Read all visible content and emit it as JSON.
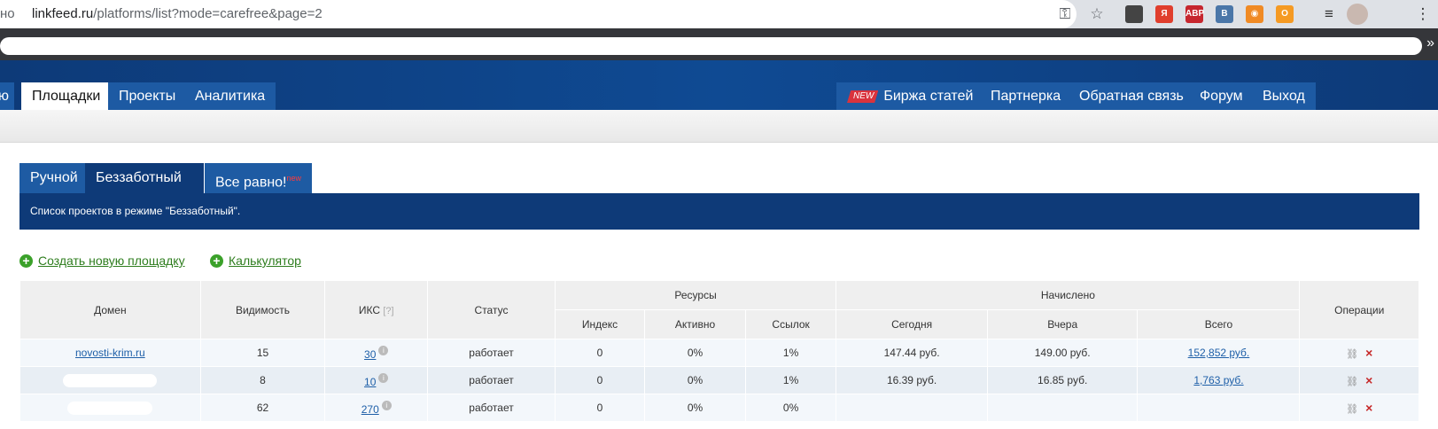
{
  "browser": {
    "url_prefix": "но",
    "url_host": "linkfeed.ru",
    "url_path": "/platforms/list?mode=carefree&page=2",
    "extensions": [
      {
        "name": "ext-ink-icon",
        "label": "",
        "color": "#444444"
      },
      {
        "name": "yandex-icon",
        "label": "Я",
        "color": "#e03e2d"
      },
      {
        "name": "adblock-icon",
        "label": "ABP",
        "color": "#c6262e"
      },
      {
        "name": "vk-icon",
        "label": "B",
        "color": "#4a76a8"
      },
      {
        "name": "rss-icon",
        "label": "◉",
        "color": "#f08a24"
      },
      {
        "name": "odnoklassniki-icon",
        "label": "О",
        "color": "#f59a23"
      }
    ],
    "more_label": "»"
  },
  "nav": {
    "left_partial": "ю",
    "items": [
      "Площадки",
      "Проекты",
      "Аналитика"
    ],
    "active": "Площадки",
    "new_badge": "NEW",
    "right_items": [
      "Биржа статей",
      "Партнерка",
      "Обратная связь",
      "Форум",
      "Выход"
    ]
  },
  "mode_tabs": {
    "items": [
      "Ручной",
      "Беззаботный",
      "Все равно!"
    ],
    "active": "Беззаботный",
    "new_sup": "new"
  },
  "info_text": "Список проектов в режиме \"Беззаботный\".",
  "actions": {
    "create": "Создать новую площадку",
    "calculator": "Калькулятор"
  },
  "table": {
    "headers": {
      "domain": "Домен",
      "visibility": "Видимость",
      "iks": "ИКС",
      "iks_help": "[?]",
      "status": "Статус",
      "resources": "Ресурсы",
      "index": "Индекс",
      "active": "Активно",
      "links": "Ссылок",
      "accrued": "Начислено",
      "today": "Сегодня",
      "yesterday": "Вчера",
      "total": "Всего",
      "operations": "Операции"
    },
    "rows": [
      {
        "domain": "novosti-krim.ru",
        "visibility": "15",
        "iks": "30",
        "status": "работает",
        "index": "0",
        "active": "0%",
        "links": "1%",
        "today": "147.44 руб.",
        "yesterday": "149.00 руб.",
        "total": "152,852 руб."
      },
      {
        "domain": "",
        "visibility": "8",
        "iks": "10",
        "status": "работает",
        "index": "0",
        "active": "0%",
        "links": "1%",
        "today": "16.39 руб.",
        "yesterday": "16.85 руб.",
        "total": "1,763 руб."
      },
      {
        "domain": "",
        "visibility": "62",
        "iks": "270",
        "status": "работает",
        "index": "0",
        "active": "0%",
        "links": "0%",
        "today": "",
        "yesterday": "",
        "total": ""
      }
    ]
  },
  "colors": {
    "header_blue": "#0e3a78",
    "tab_blue": "#1e5ba3",
    "link_green": "#2e7d1e",
    "link_blue": "#1e5fa8"
  }
}
